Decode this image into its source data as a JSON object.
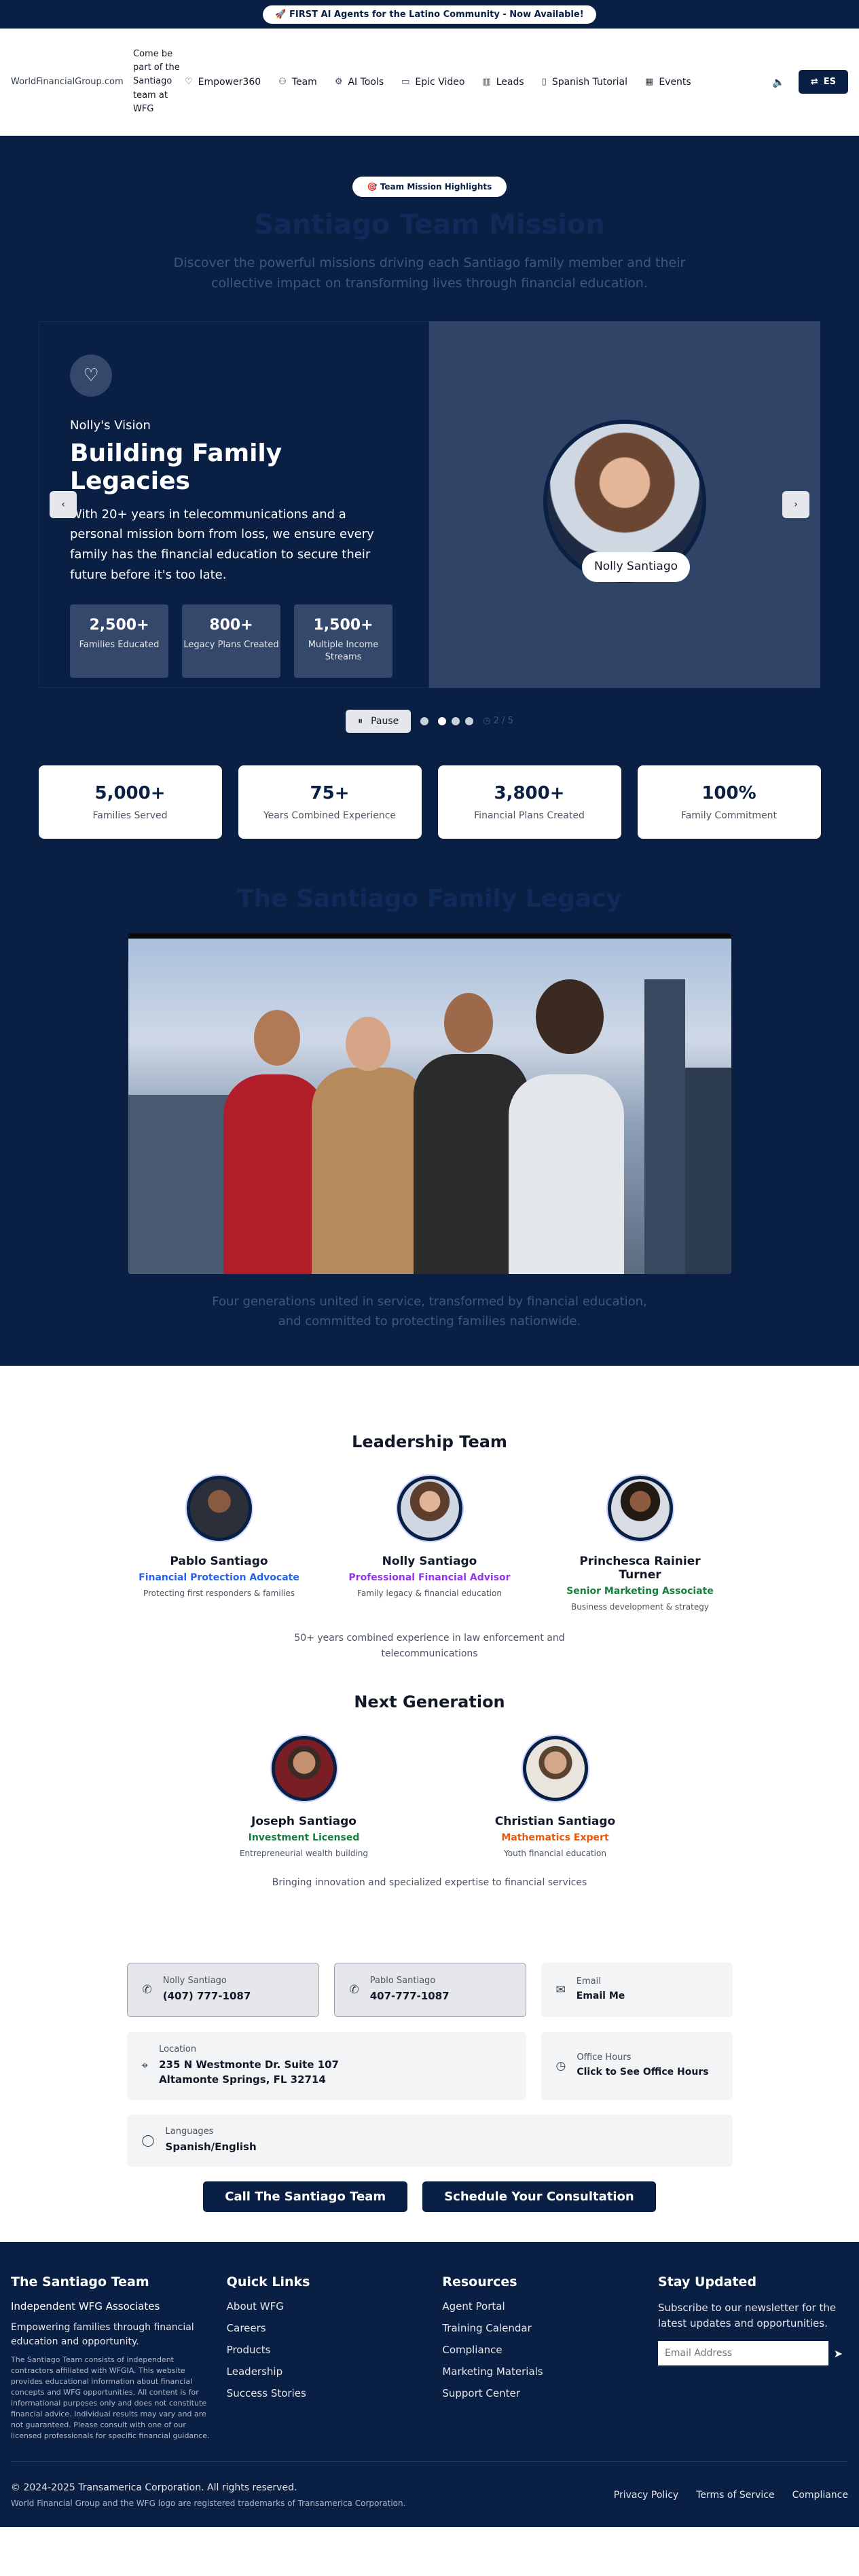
{
  "announcement": "🚀 FIRST AI Agents for the Latino Community - Now Available!",
  "nav": {
    "brand": "WorldFinancialGroup.com",
    "tagline": "Come be part of the Santiago team at WFG",
    "links": [
      {
        "label": "Empower360",
        "icon": "heart-icon"
      },
      {
        "label": "Team",
        "icon": "users-icon"
      },
      {
        "label": "AI Tools",
        "icon": "robot-icon"
      },
      {
        "label": "Epic Video",
        "icon": "video-icon"
      },
      {
        "label": "Leads",
        "icon": "chart-icon"
      },
      {
        "label": "Spanish Tutorial",
        "icon": "book-icon"
      },
      {
        "label": "Events",
        "icon": "calendar-icon"
      }
    ],
    "sound_icon": "🔈",
    "language_label": "ES"
  },
  "hero": {
    "badge": "🎯 Team Mission Highlights",
    "title": "Santiago Team Mission",
    "subtitle": "Discover the powerful missions driving each Santiago family member and their collective impact on transforming lives through financial education.",
    "slide": {
      "kicker": "Nolly's Vision",
      "title": "Building Family Legacies",
      "description": "With 20+ years in telecommunications and a personal mission born from loss, we ensure every family has the financial education to secure their future before it's too late.",
      "stats": [
        {
          "value": "2,500+",
          "label": "Families Educated"
        },
        {
          "value": "800+",
          "label": "Legacy Plans Created"
        },
        {
          "value": "1,500+",
          "label": "Multiple Income Streams"
        }
      ],
      "name_tag": "Nolly Santiago"
    },
    "pause_label": "Pause",
    "counter": "2 / 5",
    "active_slide": 2
  },
  "metrics": [
    {
      "value": "5,000+",
      "label": "Families Served"
    },
    {
      "value": "75+",
      "label": "Years Combined Experience"
    },
    {
      "value": "3,800+",
      "label": "Financial Plans Created"
    },
    {
      "value": "100%",
      "label": "Family Commitment"
    }
  ],
  "family": {
    "title": "The Santiago Family Legacy",
    "caption": "Four generations united in service, transformed by financial education, and committed to protecting families nationwide."
  },
  "leadership": {
    "title": "Leadership Team",
    "members": [
      {
        "name": "Pablo Santiago",
        "role": "Financial Protection Advocate",
        "role_color": "#2563eb",
        "desc": "Protecting first responders & families"
      },
      {
        "name": "Nolly Santiago",
        "role": "Professional Financial Advisor",
        "role_color": "#9333ea",
        "desc": "Family legacy & financial education"
      },
      {
        "name": "Princhesca Rainier Turner",
        "role": "Senior Marketing Associate",
        "role_color": "#15803d",
        "desc": "Business development & strategy"
      }
    ],
    "note": "50+ years combined experience in law enforcement and telecommunications"
  },
  "next_gen": {
    "title": "Next Generation",
    "members": [
      {
        "name": "Joseph Santiago",
        "role": "Investment Licensed",
        "role_color": "#15803d",
        "desc": "Entrepreneurial wealth building"
      },
      {
        "name": "Christian Santiago",
        "role": "Mathematics Expert",
        "role_color": "#ea580c",
        "desc": "Youth financial education"
      }
    ],
    "note": "Bringing innovation and specialized expertise to financial services"
  },
  "contact": {
    "nolly": {
      "label": "Nolly Santiago",
      "value": "(407) 777-1087"
    },
    "pablo": {
      "label": "Pablo Santiago",
      "value": "407-777-1087"
    },
    "email": {
      "label": "Email",
      "value": "Email Me"
    },
    "location": {
      "label": "Location",
      "line1": "235 N Westmonte Dr. Suite 107",
      "line2": "Altamonte Springs, FL 32714"
    },
    "hours": {
      "label": "Office Hours",
      "value": "Click to See Office Hours"
    },
    "languages": {
      "label": "Languages",
      "value": "Spanish/English"
    },
    "cta_call": "Call The Santiago Team",
    "cta_schedule": "Schedule Your Consultation"
  },
  "footer": {
    "brand": "The Santiago Team",
    "tagline": "Independent WFG Associates",
    "mission": "Empowering families through financial education and opportunity.",
    "disclaimer": "The Santiago Team consists of independent contractors affiliated with WFGIA. This website provides educational information about financial concepts and WFG opportunities. All content is for informational purposes only and does not constitute financial advice. Individual results may vary and are not guaranteed. Please consult with one of our licensed professionals for specific financial guidance.",
    "quick_links_title": "Quick Links",
    "quick_links": [
      "About WFG",
      "Careers",
      "Products",
      "Leadership",
      "Success Stories"
    ],
    "resources_title": "Resources",
    "resources": [
      "Agent Portal",
      "Training Calendar",
      "Compliance",
      "Marketing Materials",
      "Support Center"
    ],
    "newsletter_title": "Stay Updated",
    "newsletter_text": "Subscribe to our newsletter for the latest updates and opportunities.",
    "email_placeholder": "Email Address",
    "copyright": "© 2024-2025 Transamerica Corporation. All rights reserved.",
    "trademark": "World Financial Group and the WFG logo are registered trademarks of Transamerica Corporation.",
    "bottom_links": [
      "Privacy Policy",
      "Terms of Service",
      "Compliance"
    ]
  }
}
